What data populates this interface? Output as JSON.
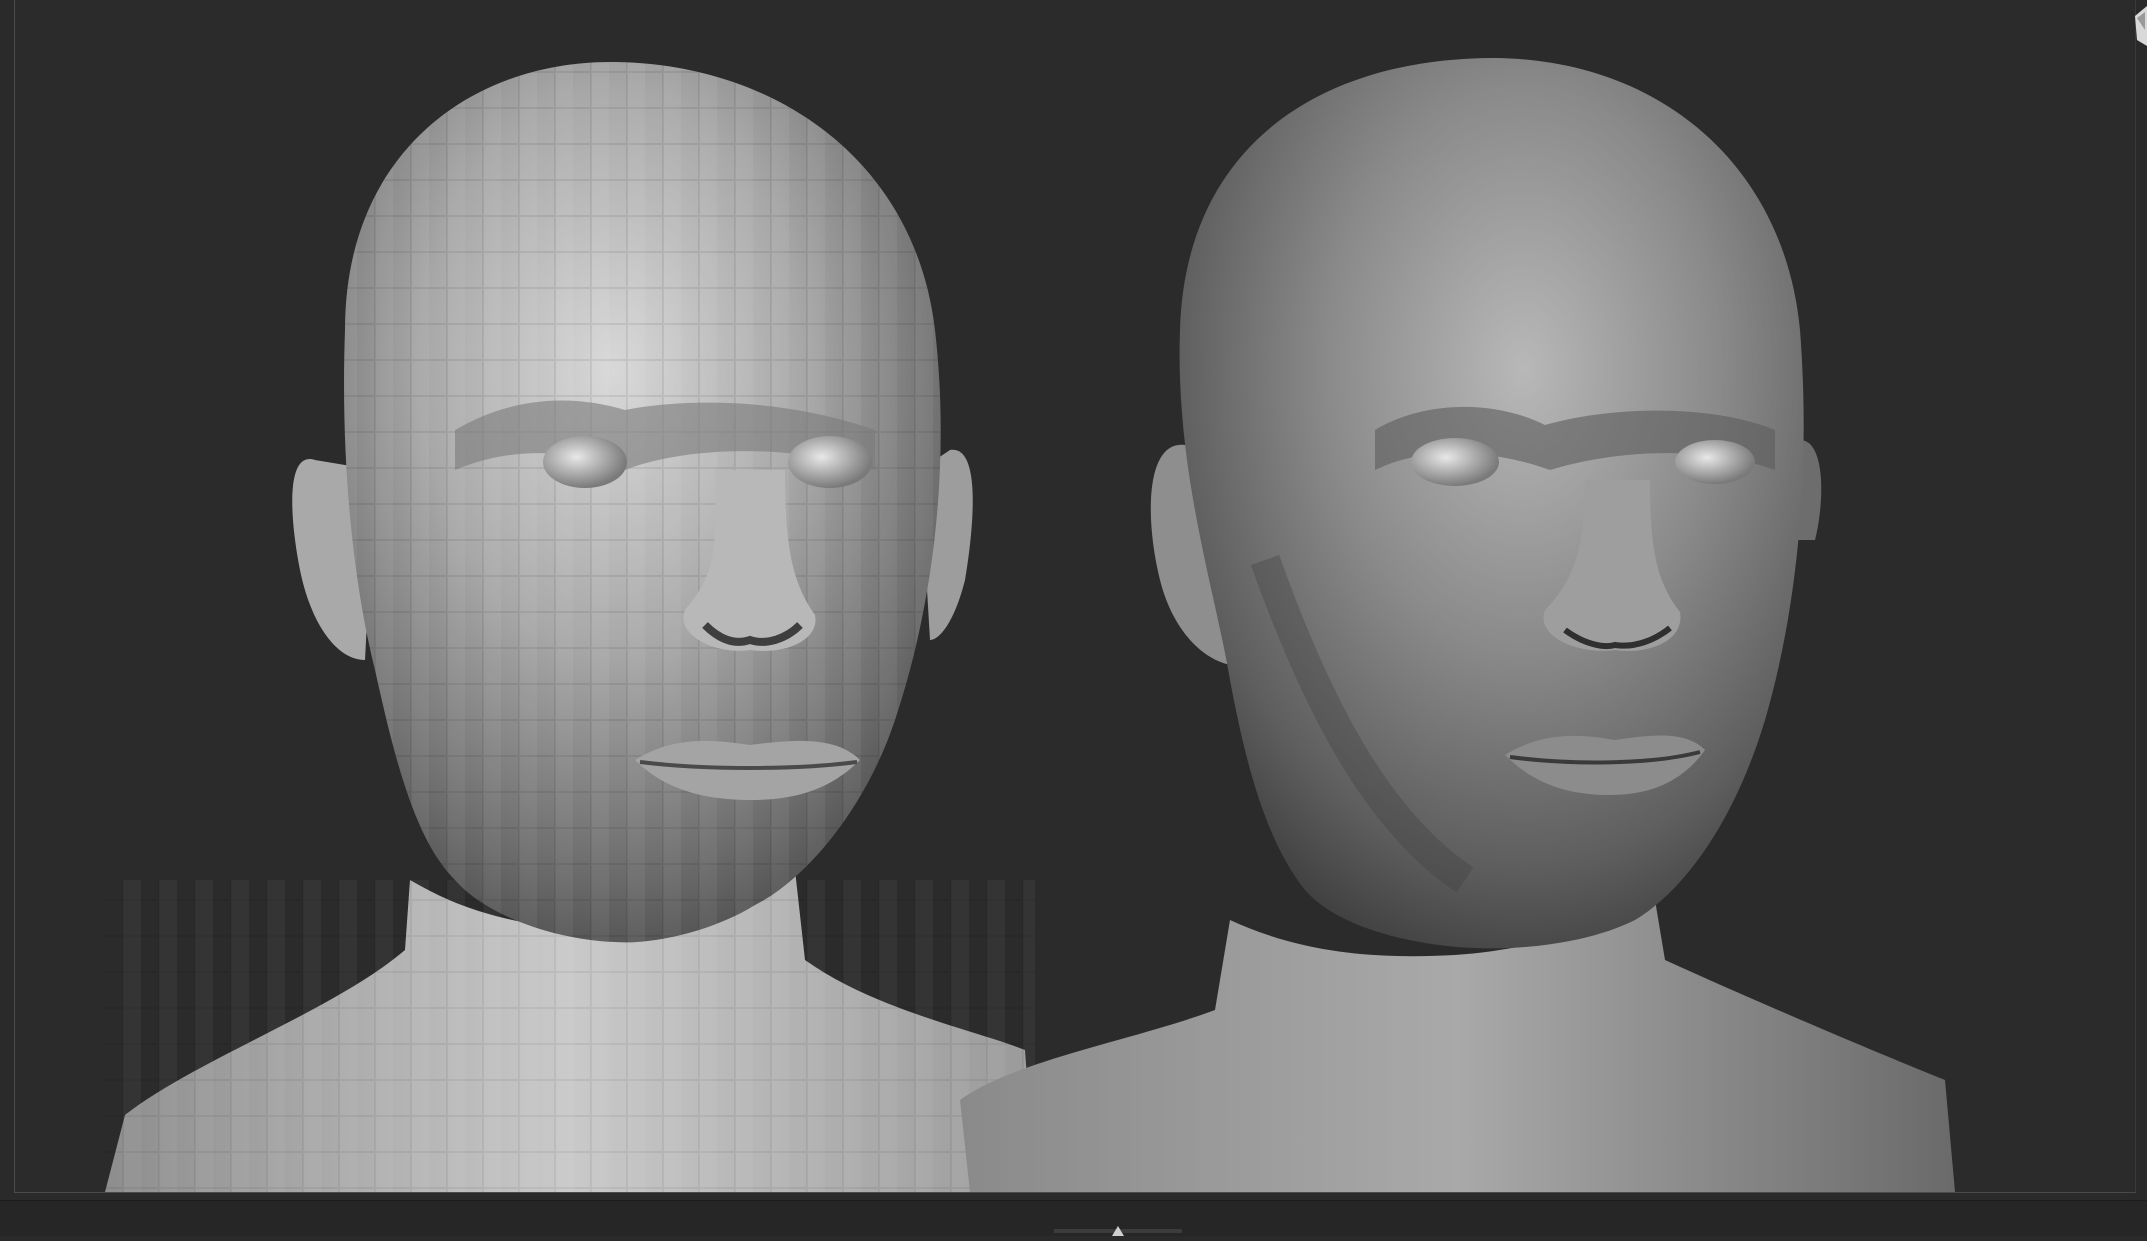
{
  "app": {
    "viewport_background": "#2a2a2a",
    "accent_outline": "#f2f2f2"
  },
  "icons": {
    "corner": "orientation-gizmo-icon",
    "bottom": "resize-handle-icon"
  },
  "models": [
    {
      "name": "low-poly-head",
      "shading": "faceted"
    },
    {
      "name": "high-poly-head",
      "shading": "smooth"
    }
  ]
}
